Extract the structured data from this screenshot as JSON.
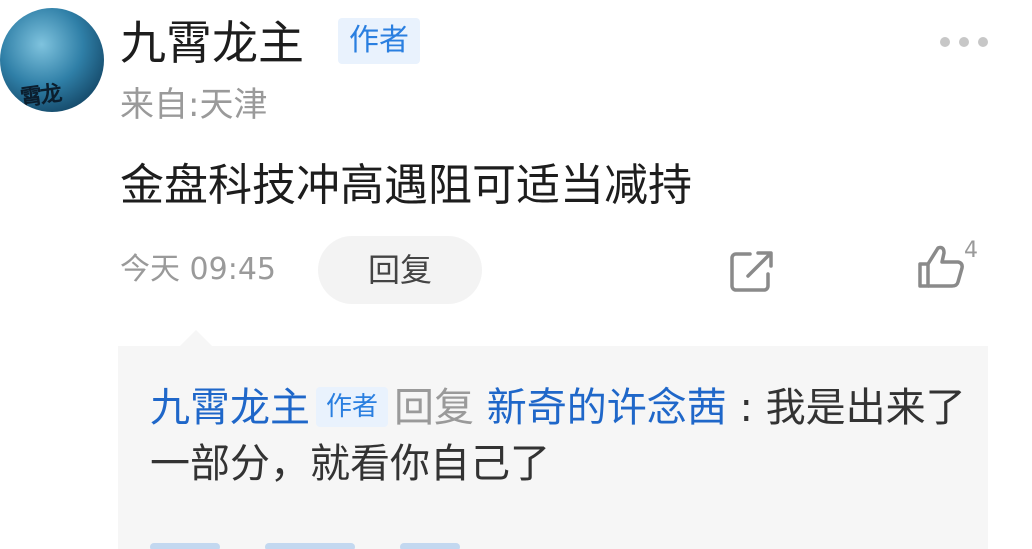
{
  "post": {
    "username": "九霄龙主",
    "author_badge": "作者",
    "location": "来自:天津",
    "body": "金盘科技冲高遇阻可适当减持",
    "timestamp": "今天 09:45",
    "reply_label": "回复",
    "like_count": "4"
  },
  "reply": {
    "author": "九霄龙主",
    "author_badge": "作者",
    "verb": "回复",
    "target": "新奇的许念茜",
    "colon": ":",
    "text": "我是出来了一部分，就看你自己了"
  },
  "icons": {
    "more": "more-dots-icon",
    "share": "share-external-icon",
    "like": "thumbs-up-icon"
  },
  "colors": {
    "accent": "#2a7fe0",
    "link_name": "#1f67c9",
    "muted": "#9a9a9a",
    "reply_bg": "#f6f6f6"
  }
}
